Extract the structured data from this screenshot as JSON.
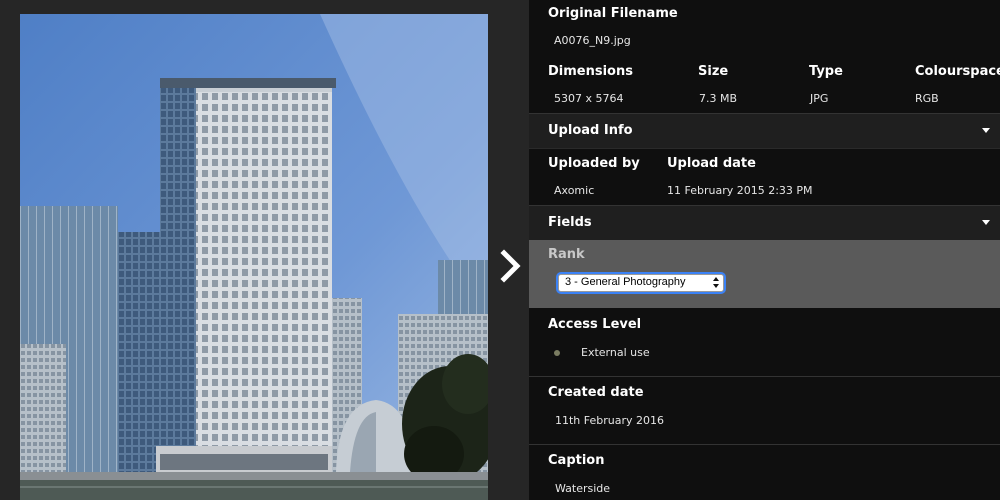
{
  "details": {
    "original_filename_label": "Original Filename",
    "original_filename": "A0076_N9.jpg",
    "dimensions_label": "Dimensions",
    "dimensions": "5307 x 5764",
    "size_label": "Size",
    "size": "7.3 MB",
    "type_label": "Type",
    "type": "JPG",
    "colourspace_label": "Colourspace",
    "colourspace": "RGB"
  },
  "upload_info": {
    "title": "Upload Info",
    "uploaded_by_label": "Uploaded by",
    "uploaded_by": "Axomic",
    "upload_date_label": "Upload date",
    "upload_date": "11 February 2015 2:33 PM"
  },
  "fields": {
    "title": "Fields",
    "rank_label": "Rank",
    "rank_value": "3 - General Photography",
    "access_level_label": "Access Level",
    "access_level": "External use",
    "created_date_label": "Created date",
    "created_date": "11th February 2016",
    "caption_label": "Caption",
    "caption": "Waterside"
  },
  "icons": {
    "next": "chevron-right-icon",
    "collapse": "caret-down-icon",
    "status": "dot-icon"
  },
  "colors": {
    "panel_bg": "#0f0f0f",
    "section_header_bg": "#1f1f1f",
    "rank_band_bg": "#5a5a5a",
    "status_dot": "#7a7c61",
    "focus_ring": "#3b82f6"
  }
}
